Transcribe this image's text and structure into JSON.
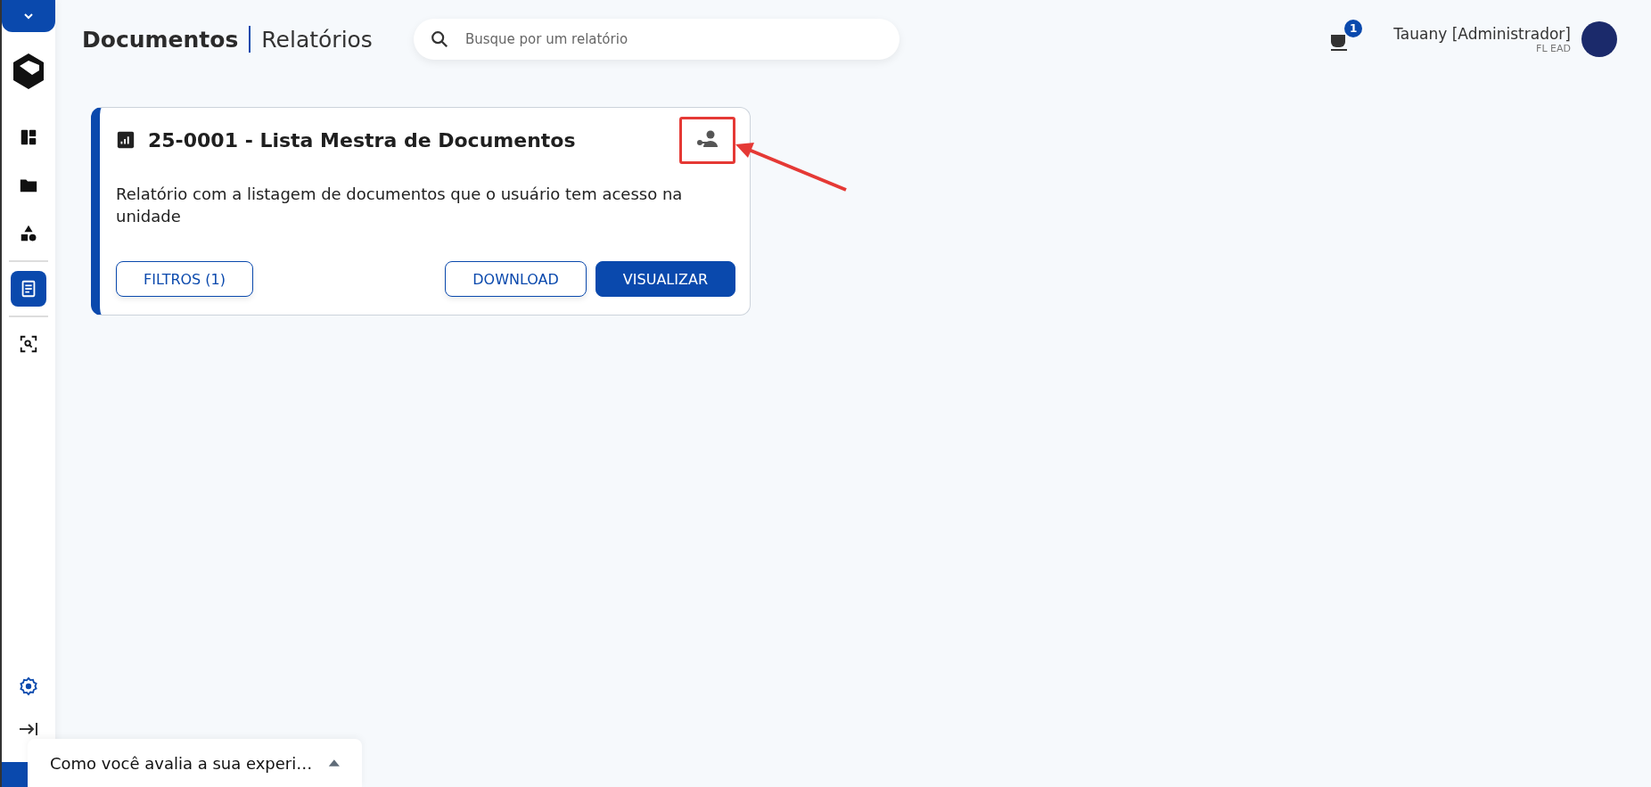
{
  "sidebar": {
    "items": [
      {
        "selected": false
      },
      {
        "selected": false
      },
      {
        "selected": false
      },
      {
        "selected": true
      },
      {
        "selected": false
      }
    ]
  },
  "header": {
    "section": "Documentos",
    "page": "Relatórios",
    "search": {
      "placeholder": "Busque por um relatório"
    },
    "notifications": {
      "count": "1"
    },
    "user": {
      "name": "Tauany [Administrador]",
      "unit": "FL EAD"
    }
  },
  "reports": [
    {
      "title": "25-0001 - Lista Mestra de Documentos",
      "description": "Relatório com a listagem de documentos que o usuário tem acesso na unidade",
      "highlighted": true,
      "buttons": [
        {
          "label": "FILTROS (1)",
          "kind": "outlined"
        },
        {
          "label": "DOWNLOAD",
          "kind": "outlined"
        },
        {
          "label": "VISUALIZAR",
          "kind": "filled"
        }
      ]
    }
  ],
  "feedback": {
    "text": "Como você avalia a sua experi…",
    "expanded": false
  }
}
